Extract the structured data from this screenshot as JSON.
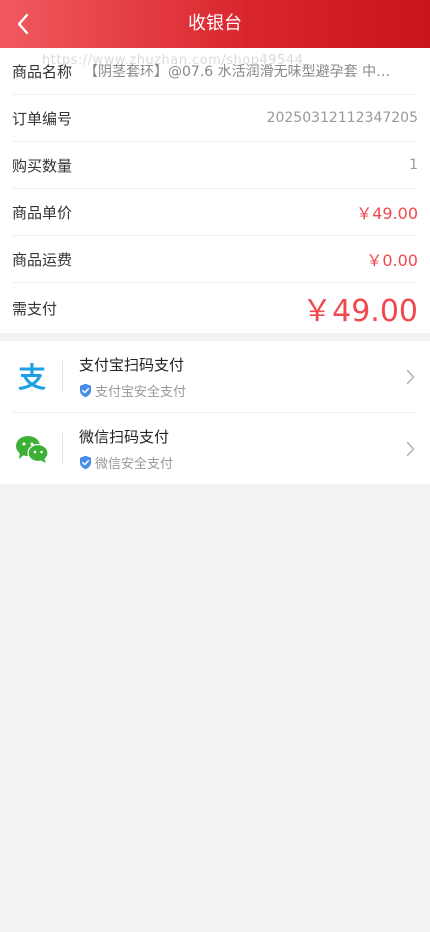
{
  "header": {
    "title": "收银台"
  },
  "order": {
    "name_label": "商品名称",
    "name_value": "【阴茎套环】@07.6 水活润滑无味型避孕套 中…",
    "watermark": "https://www.zhuzhan.com/shop49544",
    "number_label": "订单编号",
    "number_value": "20250312112347205",
    "qty_label": "购买数量",
    "qty_value": "1",
    "price_label": "商品单价",
    "price_value": "￥49.00",
    "shipping_label": "商品运费",
    "shipping_value": "￥0.00",
    "total_label": "需支付",
    "total_value": "￥49.00"
  },
  "payments": [
    {
      "title": "支付宝扫码支付",
      "sub": "支付宝安全支付",
      "icon": "alipay-icon"
    },
    {
      "title": "微信扫码支付",
      "sub": "微信安全支付",
      "icon": "wechat-icon"
    }
  ],
  "colors": {
    "accent": "#d8242b",
    "price": "#f0484e",
    "alipay": "#1c9fe5",
    "wechat": "#3cb034",
    "shield": "#4a8ae8"
  }
}
